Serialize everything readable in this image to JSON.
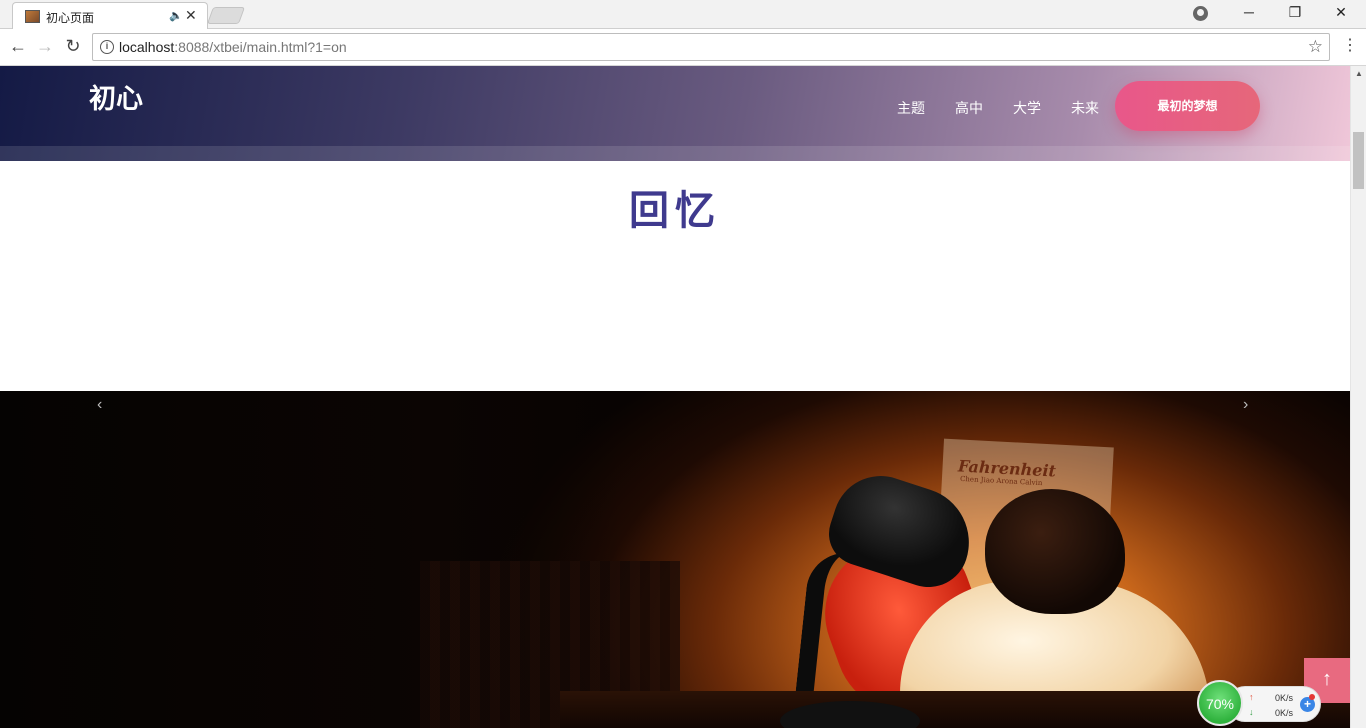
{
  "browser": {
    "tab_title": "初心页面",
    "url_host": "localhost",
    "url_rest": ":8088/xtbei/main.html?1=on"
  },
  "site": {
    "logo": "初心",
    "nav": [
      "主题",
      "高中",
      "大学",
      "未来"
    ],
    "cta_label": "最初的梦想"
  },
  "section": {
    "title": "回忆"
  },
  "hero": {
    "poster_title": "Fahrenheit",
    "poster_subtitle": "Chen Jiao Arona Calvin"
  },
  "widget": {
    "percent": "70%",
    "upload": "0K/s",
    "download": "0K/s"
  },
  "colors": {
    "title": "#3f3a8e",
    "cta": "#e8578a",
    "back_top": "#e86a80"
  }
}
